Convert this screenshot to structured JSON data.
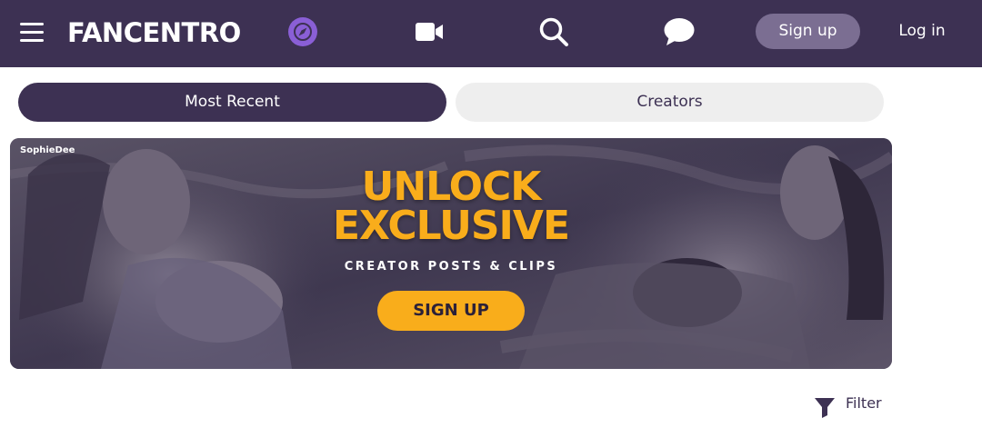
{
  "header": {
    "logo_text": "FANCENTRO",
    "signup_label": "Sign up",
    "login_label": "Log in",
    "icons": [
      "menu-icon",
      "compass-icon",
      "video-camera-icon",
      "search-icon",
      "chat-bubble-icon"
    ],
    "colors": {
      "bar": "#3d3153",
      "signup_bg": "#7b6e92",
      "compass_bg": "#8a5fd6"
    }
  },
  "tabs": [
    {
      "label": "Most Recent",
      "active": true
    },
    {
      "label": "Creators",
      "active": false
    }
  ],
  "banner": {
    "watermark": "SophieDee",
    "title_line1": "UNLOCK",
    "title_line2": "EXCLUSIVE",
    "subtitle": "CREATOR POSTS & CLIPS",
    "cta_label": "SIGN UP",
    "colors": {
      "accent": "#f9ad1b",
      "overlay": "#4a4258"
    }
  },
  "filter": {
    "label": "Filter",
    "icon": "funnel-icon"
  }
}
